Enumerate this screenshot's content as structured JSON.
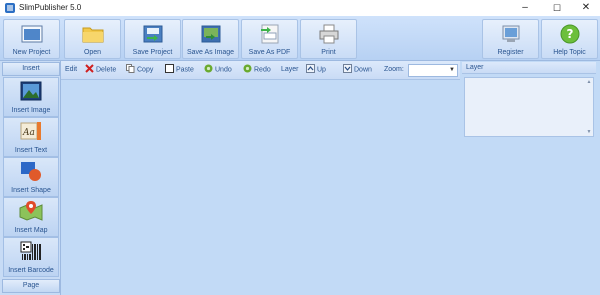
{
  "window": {
    "title": "SlimPublisher 5.0",
    "min_glyph": "–",
    "max_glyph": "☐",
    "close_glyph": "✕"
  },
  "toolbar": {
    "new_project": "New Project",
    "open": "Open",
    "save_project": "Save Project",
    "save_as_image": "Save As Image",
    "save_as_pdf": "Save As PDF",
    "print": "Print",
    "register": "Register",
    "help_topic": "Help Topic"
  },
  "left_panel": {
    "insert_header": "Insert",
    "insert_image": "Insert Image",
    "insert_text": "Insert Text",
    "insert_shape": "Insert Shape",
    "insert_map": "Insert Map",
    "insert_barcode": "Insert Barcode",
    "page_header": "Page"
  },
  "edit_toolbar": {
    "edit": "Edit",
    "delete": "Delete",
    "copy": "Copy",
    "paste": "Paste",
    "undo": "Undo",
    "redo": "Redo",
    "layer": "Layer",
    "up": "Up",
    "down": "Down",
    "zoom": "Zoom:",
    "zoom_value": ""
  },
  "layer_panel": {
    "title": "Layer"
  },
  "colors": {
    "canvas": "#c2daf6",
    "toolbar": "#c9dcf6",
    "accent": "#2a5590"
  }
}
